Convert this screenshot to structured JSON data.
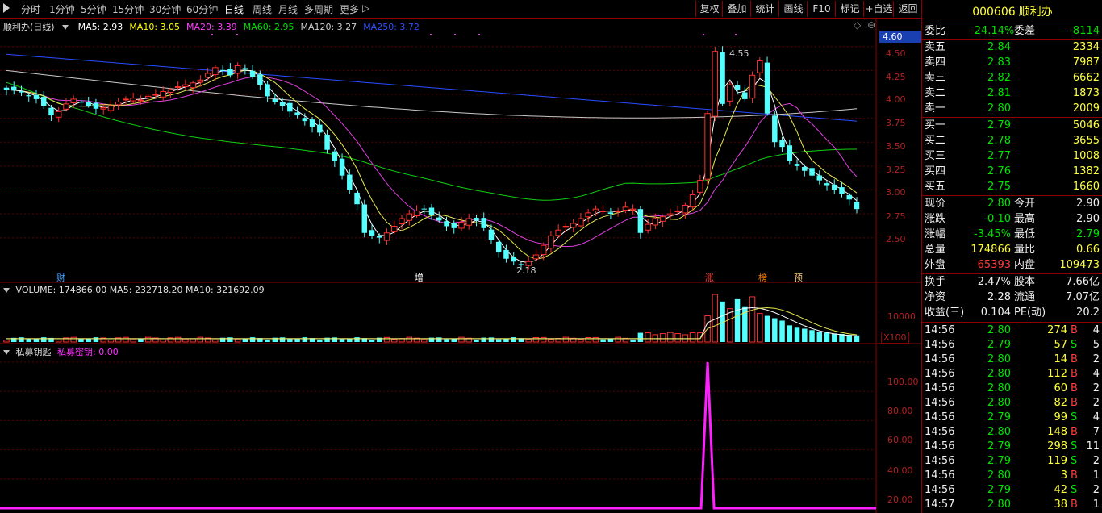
{
  "toolbar": {
    "periods": [
      "分时",
      "1分钟",
      "5分钟",
      "15分钟",
      "30分钟",
      "60分钟",
      "日线",
      "周线",
      "月线",
      "多周期",
      "更多"
    ],
    "active_period": "日线",
    "right_buttons": [
      "复权",
      "叠加",
      "统计",
      "画线",
      "F10",
      "标记",
      "+自选",
      "返回"
    ]
  },
  "main_chart": {
    "title": "顺利办(日线)",
    "ma_labels": [
      {
        "text": "MA5: 2.93",
        "color": "#ffffff"
      },
      {
        "text": "MA10: 3.05",
        "color": "#ffff00"
      },
      {
        "text": "MA20: 3.39",
        "color": "#ff40ff"
      },
      {
        "text": "MA60: 2.95",
        "color": "#00e000"
      },
      {
        "text": "MA120: 3.27",
        "color": "#d0d0d0"
      },
      {
        "text": "MA250: 3.72",
        "color": "#3050ff"
      }
    ],
    "price_axis": [
      "4.50",
      "4.25",
      "4.00",
      "3.75",
      "3.50",
      "3.25",
      "3.00",
      "2.75",
      "2.50"
    ],
    "current_price_tag": "4.60",
    "high_label": "4.55",
    "low_label": "2.18",
    "event_markers": [
      {
        "text": "财",
        "color": "#40a0ff"
      },
      {
        "text": "增",
        "color": "#ffffff"
      },
      {
        "text": "涨",
        "color": "#ff4040"
      },
      {
        "text": "榜",
        "color": "#ff8000"
      },
      {
        "text": "预",
        "color": "#ffd080"
      }
    ]
  },
  "volume_chart": {
    "legend": "VOLUME: 174866.00  MA5: 232718.20  MA10: 321692.09",
    "axis_label": "10000",
    "multiplier": "X100"
  },
  "indicator_chart": {
    "name": "私募钥匙",
    "line_label": "私募密钥: 0.00",
    "axis": [
      "100.00",
      "80.00",
      "60.00",
      "40.00",
      "20.00"
    ]
  },
  "quote": {
    "code": "000606",
    "name": "顺利办",
    "weibi_label": "委比",
    "weibi": "-24.14%",
    "weicha_label": "委差",
    "weicha": "-8114",
    "asks": [
      {
        "label": "卖五",
        "price": "2.84",
        "vol": "2334"
      },
      {
        "label": "卖四",
        "price": "2.83",
        "vol": "7987"
      },
      {
        "label": "卖三",
        "price": "2.82",
        "vol": "6662"
      },
      {
        "label": "卖二",
        "price": "2.81",
        "vol": "1873"
      },
      {
        "label": "卖一",
        "price": "2.80",
        "vol": "2009"
      }
    ],
    "bids": [
      {
        "label": "买一",
        "price": "2.79",
        "vol": "5046"
      },
      {
        "label": "买二",
        "price": "2.78",
        "vol": "3655"
      },
      {
        "label": "买三",
        "price": "2.77",
        "vol": "1008"
      },
      {
        "label": "买四",
        "price": "2.76",
        "vol": "1382"
      },
      {
        "label": "买五",
        "price": "2.75",
        "vol": "1660"
      }
    ],
    "stats1": [
      {
        "l1": "现价",
        "v1": "2.80",
        "c1": "green",
        "l2": "今开",
        "v2": "2.90",
        "c2": "white"
      },
      {
        "l1": "涨跌",
        "v1": "-0.10",
        "c1": "green",
        "l2": "最高",
        "v2": "2.90",
        "c2": "white"
      },
      {
        "l1": "涨幅",
        "v1": "-3.45%",
        "c1": "green",
        "l2": "最低",
        "v2": "2.79",
        "c2": "green"
      },
      {
        "l1": "总量",
        "v1": "174866",
        "c1": "yellow",
        "l2": "量比",
        "v2": "0.66",
        "c2": "yellow"
      },
      {
        "l1": "外盘",
        "v1": "65393",
        "c1": "red",
        "l2": "内盘",
        "v2": "109473",
        "c2": "yellow"
      }
    ],
    "stats2": [
      {
        "l1": "换手",
        "v1": "2.47%",
        "l2": "股本",
        "v2": "7.66亿"
      },
      {
        "l1": "净资",
        "v1": "2.28",
        "l2": "流通",
        "v2": "7.07亿"
      },
      {
        "l1": "收益(三)",
        "v1": "0.104",
        "l2": "PE(动)",
        "v2": "20.2"
      }
    ],
    "ticks": [
      {
        "t": "14:56",
        "p": "2.80",
        "v": "274",
        "d": "B",
        "n": "4"
      },
      {
        "t": "14:56",
        "p": "2.79",
        "v": "57",
        "d": "S",
        "n": "5"
      },
      {
        "t": "14:56",
        "p": "2.80",
        "v": "14",
        "d": "B",
        "n": "2"
      },
      {
        "t": "14:56",
        "p": "2.80",
        "v": "112",
        "d": "B",
        "n": "4"
      },
      {
        "t": "14:56",
        "p": "2.80",
        "v": "60",
        "d": "B",
        "n": "2"
      },
      {
        "t": "14:56",
        "p": "2.80",
        "v": "82",
        "d": "B",
        "n": "2"
      },
      {
        "t": "14:56",
        "p": "2.79",
        "v": "99",
        "d": "S",
        "n": "4"
      },
      {
        "t": "14:56",
        "p": "2.80",
        "v": "148",
        "d": "B",
        "n": "7"
      },
      {
        "t": "14:56",
        "p": "2.79",
        "v": "298",
        "d": "S",
        "n": "11"
      },
      {
        "t": "14:56",
        "p": "2.79",
        "v": "119",
        "d": "S",
        "n": "2"
      },
      {
        "t": "14:56",
        "p": "2.80",
        "v": "3",
        "d": "B",
        "n": "1"
      },
      {
        "t": "14:56",
        "p": "2.79",
        "v": "42",
        "d": "S",
        "n": "2"
      },
      {
        "t": "14:57",
        "p": "2.80",
        "v": "38",
        "d": "B",
        "n": "1"
      }
    ]
  },
  "chart_data": {
    "type": "candlestick",
    "price_range": [
      2.05,
      4.65
    ],
    "indicator_range": [
      0,
      105
    ],
    "closes": [
      4.05,
      4.04,
      4.02,
      3.98,
      3.95,
      3.88,
      3.78,
      3.82,
      3.9,
      3.95,
      3.92,
      3.88,
      3.85,
      3.86,
      3.88,
      3.92,
      3.95,
      3.96,
      3.94,
      3.98,
      4.0,
      4.03,
      4.05,
      4.08,
      4.1,
      4.12,
      4.15,
      4.22,
      4.28,
      4.25,
      4.2,
      4.3,
      4.26,
      4.18,
      4.1,
      3.98,
      3.92,
      3.88,
      3.82,
      3.78,
      3.72,
      3.66,
      3.6,
      3.42,
      3.3,
      3.15,
      3.0,
      2.85,
      2.55,
      2.52,
      2.5,
      2.55,
      2.62,
      2.7,
      2.75,
      2.78,
      2.8,
      2.74,
      2.68,
      2.62,
      2.6,
      2.66,
      2.7,
      2.68,
      2.6,
      2.48,
      2.35,
      2.28,
      2.25,
      2.22,
      2.25,
      2.32,
      2.42,
      2.52,
      2.58,
      2.62,
      2.65,
      2.7,
      2.76,
      2.8,
      2.78,
      2.75,
      2.78,
      2.82,
      2.8,
      2.55,
      2.64,
      2.7,
      2.72,
      2.75,
      2.78,
      2.84,
      2.95,
      3.1,
      3.8,
      4.45,
      3.9,
      4.1,
      4.05,
      3.95,
      4.2,
      4.35,
      3.8,
      3.5,
      3.45,
      3.3,
      3.25,
      3.2,
      3.15,
      3.1,
      3.05,
      3.0,
      2.96,
      2.9,
      2.8
    ],
    "volume_ma": [
      232718.2,
      321692.09
    ],
    "key_spike_index": 94
  }
}
